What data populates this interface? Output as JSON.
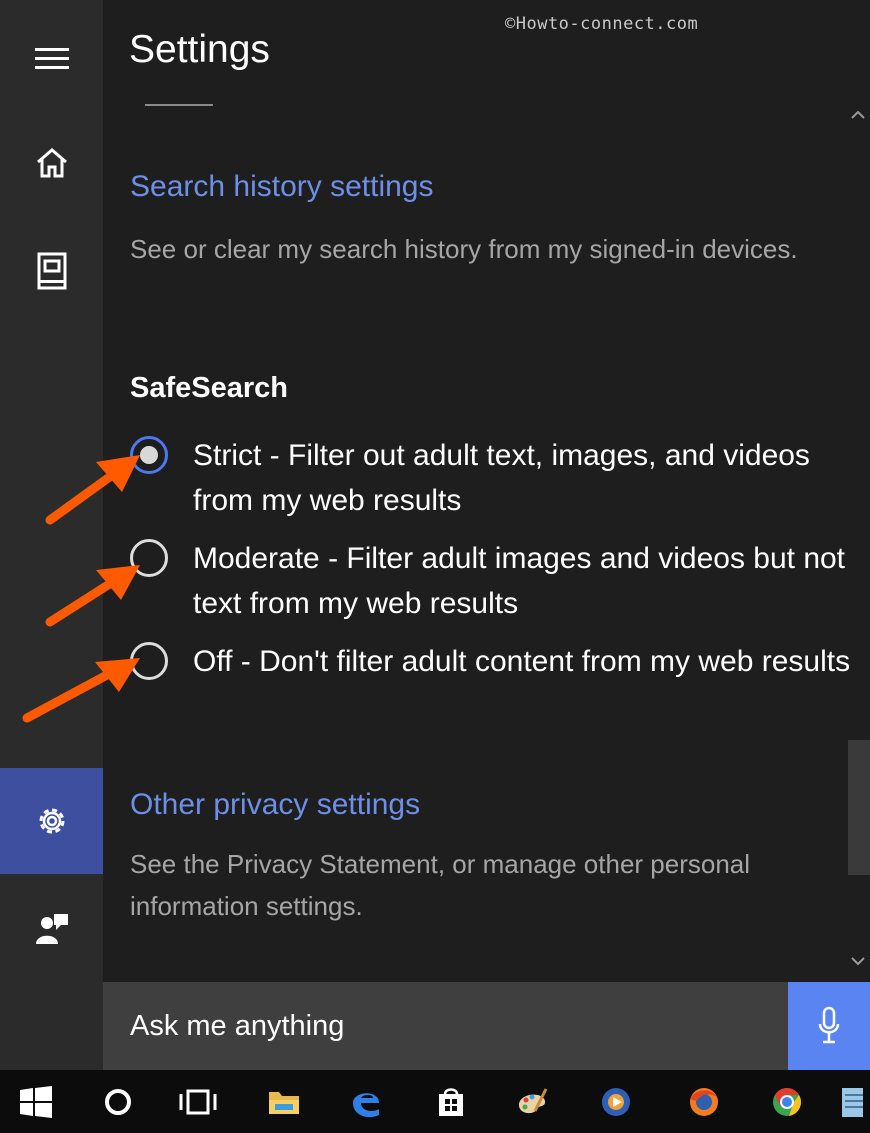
{
  "header": {
    "title": "Settings",
    "watermark": "©Howto-connect.com"
  },
  "search_history": {
    "link": "Search history settings",
    "description": "See or clear my search history from my signed-in devices."
  },
  "safesearch": {
    "heading": "SafeSearch",
    "selected": "strict",
    "options": [
      {
        "id": "strict",
        "label": "Strict - Filter out adult text, images, and videos from my web results",
        "checked": true
      },
      {
        "id": "moderate",
        "label": "Moderate - Filter adult images and videos but not text from my web results",
        "checked": false
      },
      {
        "id": "off",
        "label": "Off - Don't filter adult content from my web results",
        "checked": false
      }
    ]
  },
  "other_privacy": {
    "link": "Other privacy settings",
    "description": "See the Privacy Statement, or manage other personal information settings."
  },
  "search": {
    "placeholder": "Ask me anything"
  },
  "nav": {
    "items": [
      "hamburger-icon",
      "home-icon",
      "notebook-icon",
      "gear-icon",
      "feedback-icon"
    ],
    "active": "gear-icon"
  },
  "taskbar": {
    "items": [
      "windows-start-icon",
      "cortana-icon",
      "task-view-icon",
      "file-explorer-icon",
      "edge-icon",
      "store-icon",
      "paint-icon",
      "media-player-icon",
      "firefox-icon",
      "chrome-icon",
      "notepad-icon"
    ]
  },
  "colors": {
    "accent": "#4e78f0",
    "link": "#6e8fe8",
    "nav_active": "#3d4f9e",
    "mic_button": "#5a84f2",
    "annotation_arrow": "#ff5a00"
  }
}
